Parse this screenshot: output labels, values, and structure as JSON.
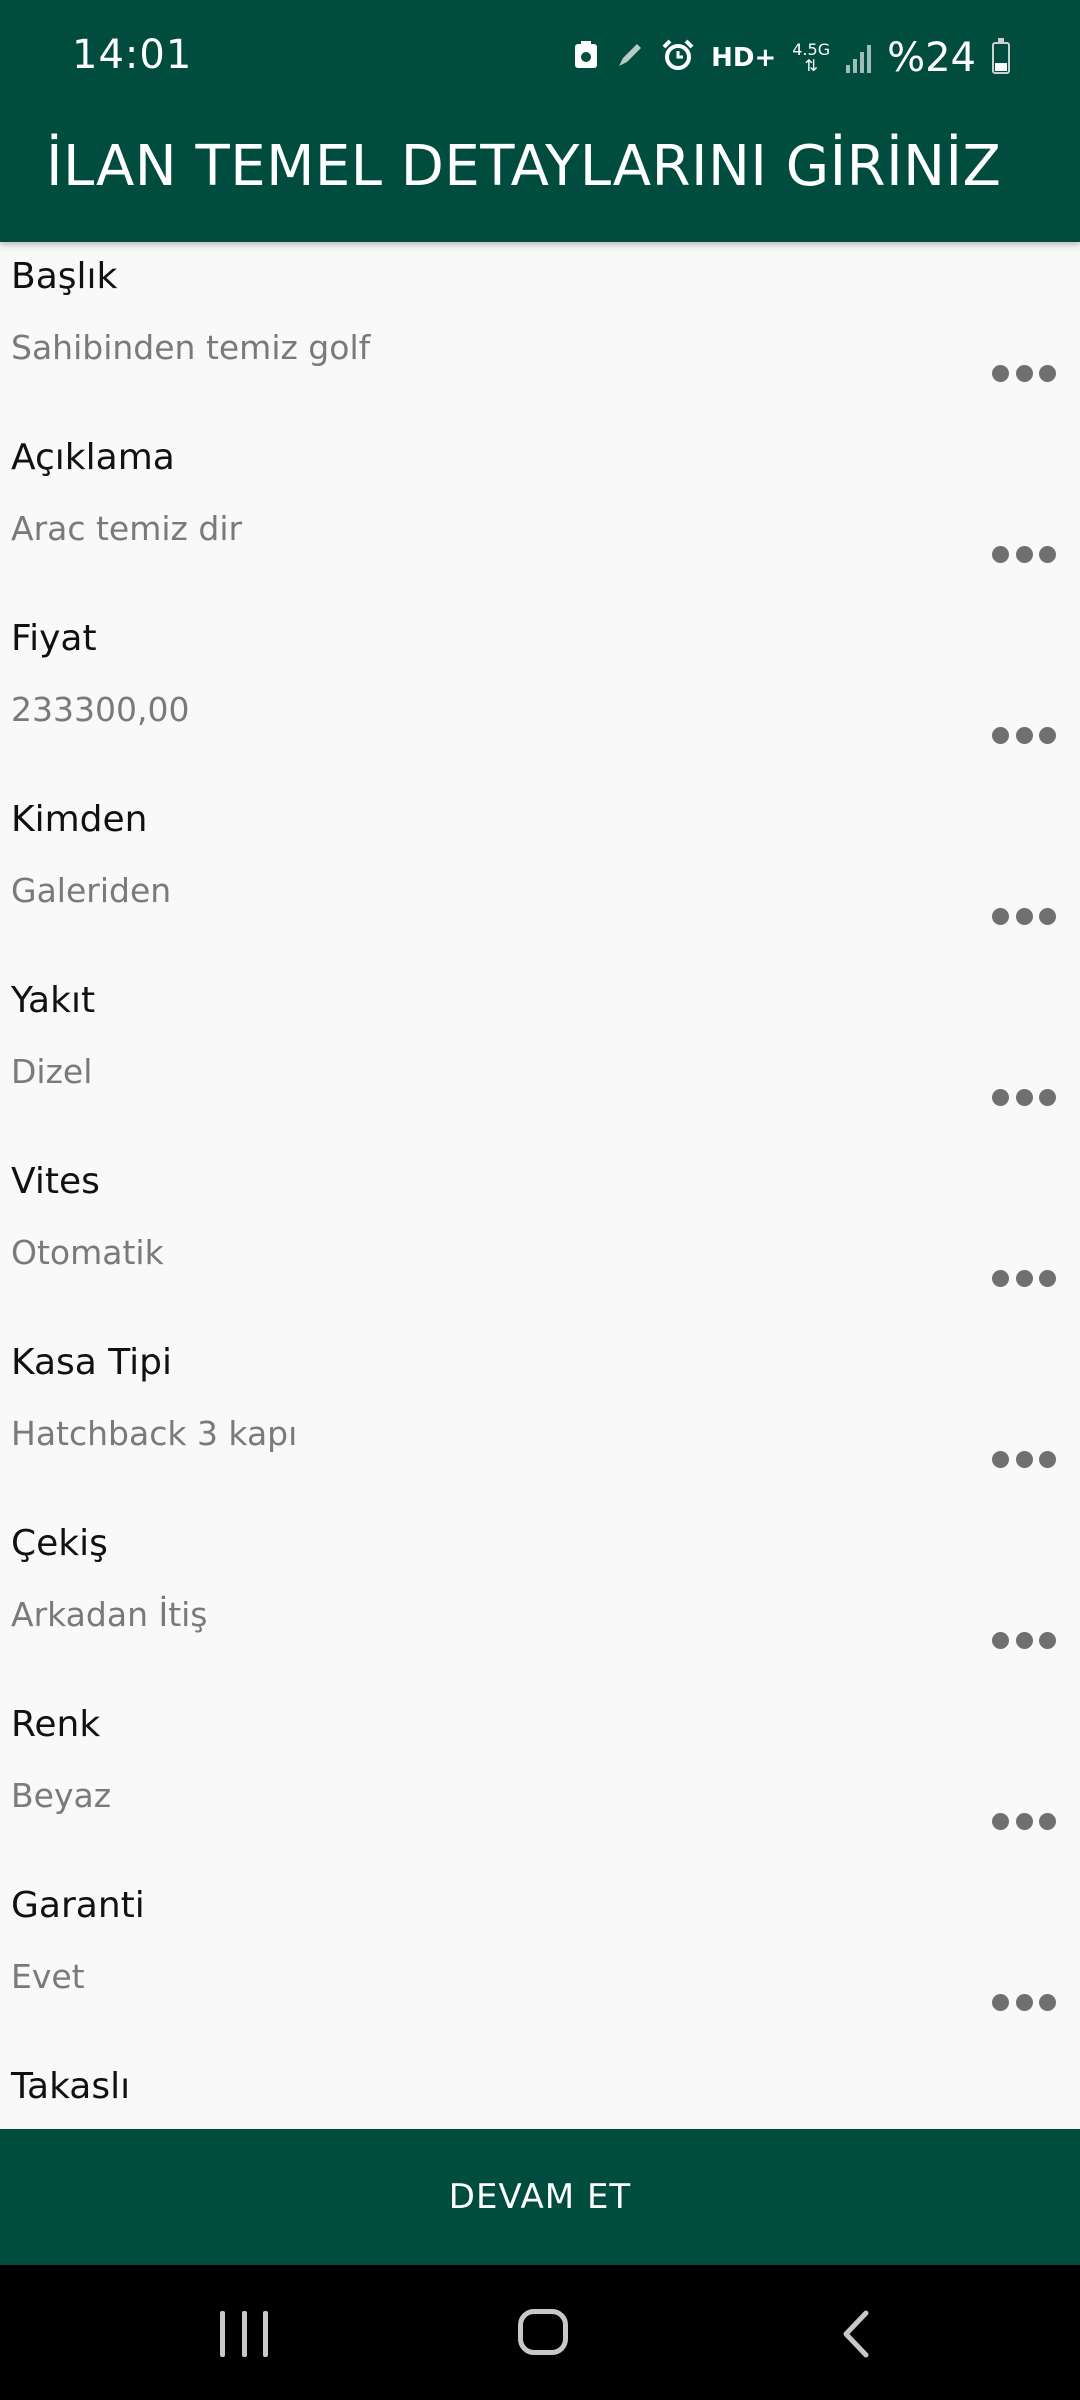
{
  "status_bar": {
    "time": "14:01",
    "icons": [
      "save-icon",
      "pen-icon",
      "alarm-icon",
      "hd-volte-icon",
      "4g-data-icon",
      "signal-icon"
    ],
    "network": "HD+",
    "data_type": "4.5G",
    "battery_text": "%24",
    "battery_percent": 24
  },
  "app_bar": {
    "title": "İLAN TEMEL DETAYLARINI GİRİNİZ"
  },
  "form": {
    "items": [
      {
        "label": "Başlık",
        "value": "Sahibinden temiz golf"
      },
      {
        "label": "Açıklama",
        "value": "Arac temiz dir"
      },
      {
        "label": "Fiyat",
        "value": "233300,00"
      },
      {
        "label": "Kimden",
        "value": "Galeriden"
      },
      {
        "label": "Yakıt",
        "value": "Dizel"
      },
      {
        "label": "Vites",
        "value": "Otomatik"
      },
      {
        "label": "Kasa Tipi",
        "value": "Hatchback 3 kapı"
      },
      {
        "label": "Çekiş",
        "value": "Arkadan İtiş"
      },
      {
        "label": "Renk",
        "value": "Beyaz"
      },
      {
        "label": "Garanti",
        "value": "Evet"
      },
      {
        "label": "Takaslı",
        "value": ""
      }
    ]
  },
  "footer": {
    "continue_label": "DEVAM ET"
  },
  "colors": {
    "primary": "#004d40",
    "background": "#f9f9f9",
    "label_text": "#111111",
    "value_text": "#7a7a7a"
  }
}
